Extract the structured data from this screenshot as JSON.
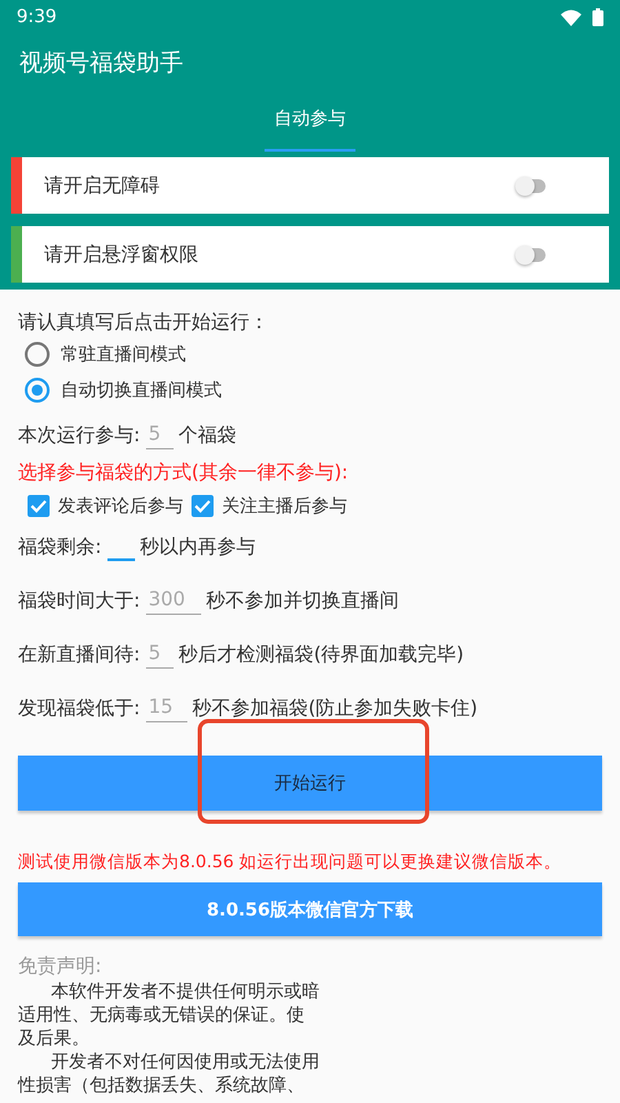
{
  "status_bar": {
    "time": "9:39"
  },
  "app_bar": {
    "title": "视频号福袋助手"
  },
  "tabs": [
    {
      "label": "自动参与",
      "selected": true
    }
  ],
  "permissions": [
    {
      "label": "请开启无障碍",
      "on": false,
      "color": "#f44336"
    },
    {
      "label": "请开启悬浮窗权限",
      "on": false,
      "color": "#4caf50"
    }
  ],
  "form": {
    "instruction": "请认真填写后点击开始运行：",
    "modes": [
      {
        "label": "常驻直播间模式",
        "selected": false
      },
      {
        "label": "自动切换直播间模式",
        "selected": true
      }
    ],
    "count_row": [
      {
        "kind": "text",
        "text": "本次运行参与:"
      },
      {
        "kind": "field",
        "placeholder": "5",
        "focused": false
      },
      {
        "kind": "text",
        "text": "个福袋"
      }
    ],
    "method_label": "选择参与福袋的方式(其余一律不参与):",
    "methods": [
      {
        "label": "发表评论后参与",
        "checked": true
      },
      {
        "label": "关注主播后参与",
        "checked": true
      }
    ],
    "rows": [
      [
        {
          "kind": "text",
          "text": "福袋剩余:"
        },
        {
          "kind": "field",
          "focused": true
        },
        {
          "kind": "text",
          "text": "秒以内再参与"
        }
      ],
      [
        {
          "kind": "text",
          "text": "福袋时间大于:"
        },
        {
          "kind": "field",
          "placeholder": "300",
          "focused": false
        },
        {
          "kind": "text",
          "text": "秒不参加并切换直播间"
        }
      ],
      [
        {
          "kind": "text",
          "text": "在新直播间待:"
        },
        {
          "kind": "field",
          "placeholder": "5",
          "focused": false
        },
        {
          "kind": "text",
          "text": "秒后才检测福袋(待界面加载完毕)"
        }
      ],
      [
        {
          "kind": "text",
          "text": "发现福袋低于:"
        },
        {
          "kind": "field",
          "placeholder": "15",
          "focused": false
        },
        {
          "kind": "text",
          "text": "秒不参加福袋(防止参加失败卡住)"
        }
      ]
    ]
  },
  "start_button": "开始运行",
  "version_note": "测试使用微信版本为8.0.56 如运行出现问题可以更换建议微信版本。",
  "download_button": "8.0.56版本微信官方下载",
  "disclaimer": {
    "heading": "免责声明:",
    "lines": [
      {
        "text": "本软件开发者不提供任何明示或暗",
        "indent": true
      },
      {
        "text": "适用性、无病毒或无错误的保证。使",
        "indent": false
      },
      {
        "text": "及后果。",
        "indent": false
      },
      {
        "text": "开发者不对任何因使用或无法使用",
        "indent": true
      },
      {
        "text": "性损害（包括数据丢失、系统故障、",
        "indent": false
      }
    ]
  }
}
